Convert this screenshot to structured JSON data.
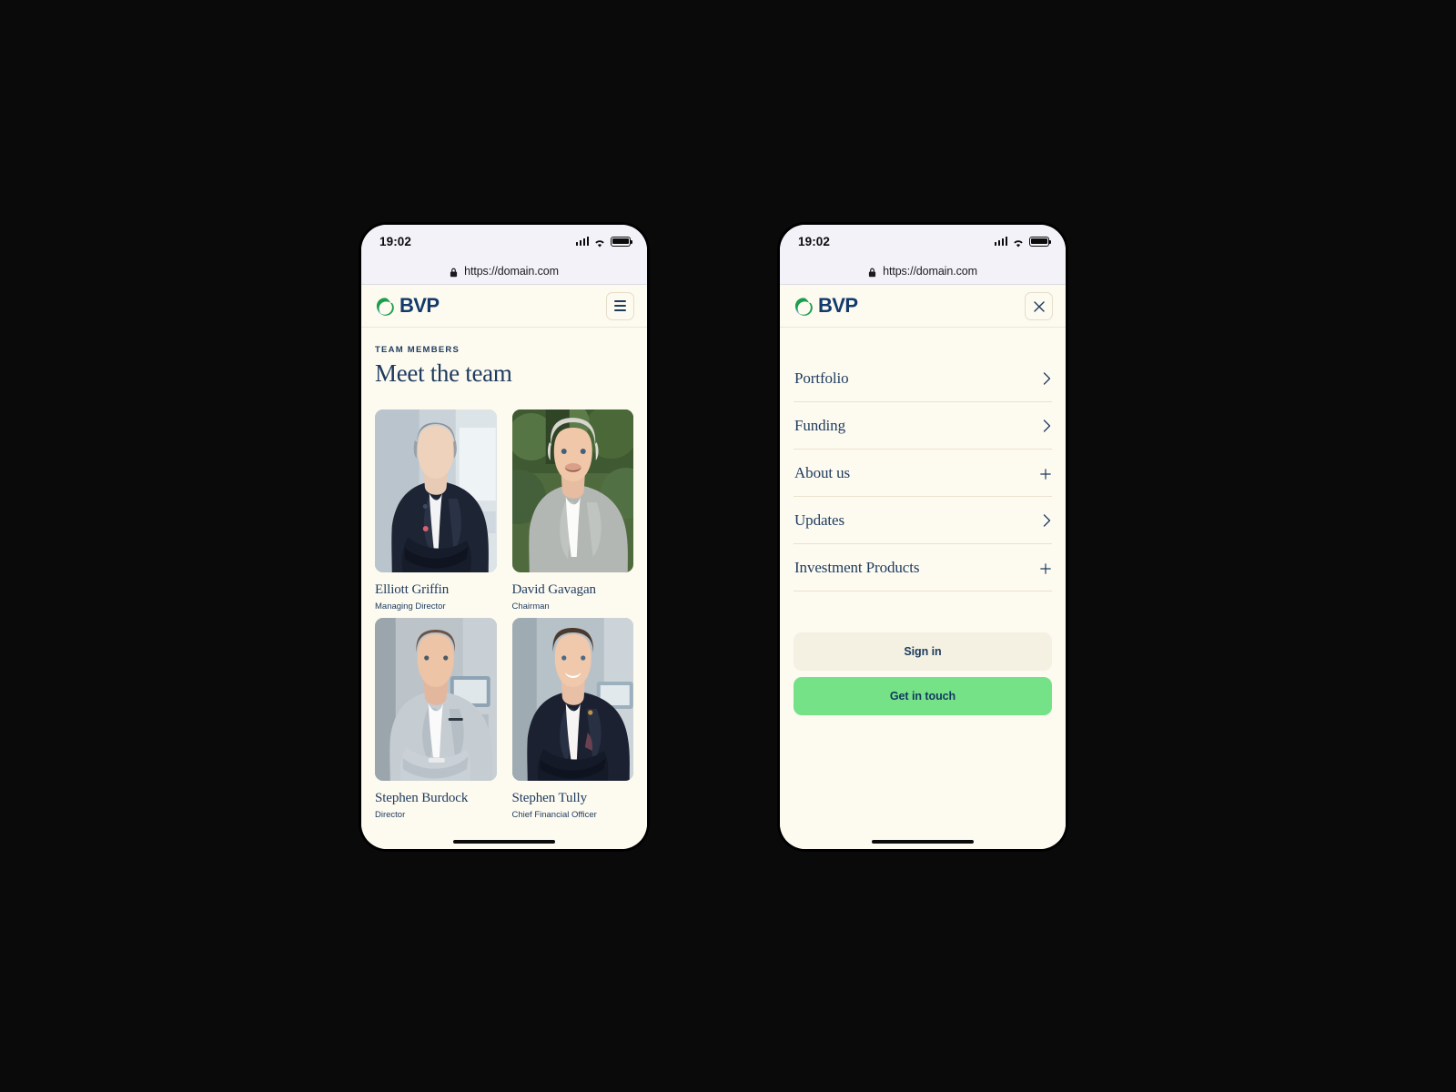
{
  "status_bar": {
    "time": "19:02",
    "signal_icon": "cellular-signal-icon",
    "wifi_icon": "wifi-icon",
    "battery_icon": "battery-full-icon"
  },
  "browser": {
    "lock_icon": "lock-icon",
    "url": "https://domain.com"
  },
  "brand": {
    "logo_icon": "bvp-swoosh-logo-icon",
    "name": "BVP"
  },
  "colors": {
    "page_background": "#fdfaf0",
    "brand_navy": "#1d3b5e",
    "logo_blue": "#123a6b",
    "accent_green": "#76e288",
    "secondary_button": "#f4f0e2",
    "divider": "#e9e2cd",
    "status_bar_background": "#f3f2f8"
  },
  "phone_left": {
    "header": {
      "menu_button_icon": "hamburger-menu-icon"
    },
    "team": {
      "eyebrow": "TEAM MEMBERS",
      "heading": "Meet the team",
      "members": [
        {
          "name": "Elliott Griffin",
          "role": "Managing Director"
        },
        {
          "name": "David Gavagan",
          "role": "Chairman"
        },
        {
          "name": "Stephen Burdock",
          "role": "Director"
        },
        {
          "name": "Stephen Tully",
          "role": "Chief Financial Officer"
        }
      ]
    }
  },
  "phone_right": {
    "header": {
      "close_button_icon": "close-x-icon"
    },
    "menu": {
      "items": [
        {
          "label": "Portfolio",
          "indicator": "chevron-right-icon"
        },
        {
          "label": "Funding",
          "indicator": "chevron-right-icon"
        },
        {
          "label": "About us",
          "indicator": "plus-icon"
        },
        {
          "label": "Updates",
          "indicator": "chevron-right-icon"
        },
        {
          "label": "Investment Products",
          "indicator": "plus-icon"
        }
      ]
    },
    "actions": {
      "sign_in": "Sign in",
      "get_in_touch": "Get in touch"
    }
  }
}
